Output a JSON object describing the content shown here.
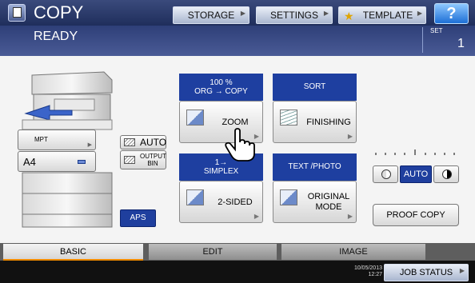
{
  "header": {
    "title": "COPY",
    "storage_label": "STORAGE",
    "settings_label": "SETTINGS",
    "template_label": "TEMPLATE",
    "help_label": "?"
  },
  "status": {
    "message": "READY",
    "set_label": "SET",
    "set_value": "1"
  },
  "paper": {
    "tray_mpt_label": "MPT",
    "tray_a4_label": "A4",
    "auto_label": "AUTO",
    "output_bin_line1": "OUTPUT",
    "output_bin_line2": "BIN",
    "aps_label": "APS"
  },
  "functions": {
    "zoom": {
      "head_line1": "100 %",
      "head_line2": "ORG → COPY",
      "label": "ZOOM",
      "icon": "zoom-icon"
    },
    "sort": {
      "head": "SORT",
      "label": "FINISHING",
      "icon": "finishing-icon"
    },
    "sided": {
      "head_line1": "1→",
      "head_line2": "SIMPLEX",
      "label": "2-SIDED",
      "icon": "duplex-icon"
    },
    "mode": {
      "head": "TEXT /PHOTO",
      "label_line1": "ORIGINAL",
      "label_line2": "MODE",
      "icon": "original-mode-icon"
    }
  },
  "density": {
    "auto_label": "AUTO"
  },
  "proof_copy_label": "PROOF COPY",
  "tabs": [
    {
      "label": "BASIC",
      "active": true
    },
    {
      "label": "EDIT",
      "active": false
    },
    {
      "label": "IMAGE",
      "active": false
    }
  ],
  "footer": {
    "date": "10/05/2013",
    "time": "12:27",
    "job_status_label": "JOB STATUS"
  },
  "colors": {
    "header": "#1f2e5c",
    "function_head": "#1e3fa0",
    "active_tab_accent": "#f08a00",
    "selected_button": "#1f3f9e"
  }
}
